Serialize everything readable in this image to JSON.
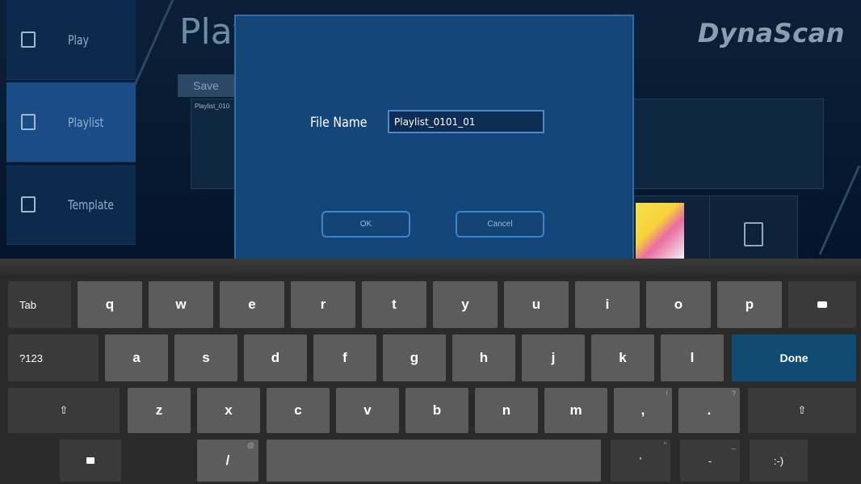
{
  "sidebar": {
    "items": [
      {
        "label": "Play",
        "icon": "play-icon"
      },
      {
        "label": "Playlist",
        "icon": "playlist-icon"
      },
      {
        "label": "Template",
        "icon": "template-icon"
      }
    ],
    "active": "Playlist"
  },
  "header": {
    "title": "Play",
    "brand": "DynaScan"
  },
  "background": {
    "save_tab": "Save",
    "playlist_item": "Playlist_010"
  },
  "dialog": {
    "field_label": "File Name",
    "field_value": "Playlist_0101_01",
    "ok_label": "OK",
    "cancel_label": "Cancel"
  },
  "keyboard": {
    "row1": {
      "tab": "Tab",
      "keys": [
        "q",
        "w",
        "e",
        "r",
        "t",
        "y",
        "u",
        "i",
        "o",
        "p"
      ],
      "backspace_icon": "backspace-icon"
    },
    "row2": {
      "mode": "?123",
      "keys": [
        "a",
        "s",
        "d",
        "f",
        "g",
        "h",
        "j",
        "k",
        "l"
      ],
      "done": "Done"
    },
    "row3": {
      "shift_icon": "shift-icon",
      "keys": [
        "z",
        "x",
        "c",
        "v",
        "b",
        "n",
        "m",
        ",",
        "."
      ],
      "hints": {
        ",": "!",
        ".": "?"
      }
    },
    "row4": {
      "settings_icon": "keyboard-settings-icon",
      "slash": "/",
      "slash_hint": "@",
      "apostrophe": "'",
      "apostrophe_hint": "\"",
      "dash": "-",
      "dash_hint": "_",
      "smiley": ":-)"
    }
  },
  "colors": {
    "accent": "#1a4d86",
    "dialog_bg": "#15467a",
    "done_key": "#0f4b73"
  }
}
